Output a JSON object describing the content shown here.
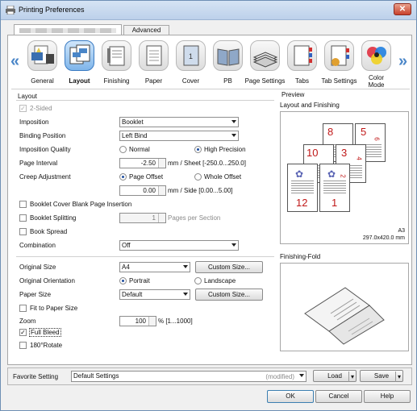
{
  "window": {
    "title": "Printing Preferences",
    "close_glyph": "✕"
  },
  "tabs": [
    {
      "label": ""
    },
    {
      "label": "Advanced"
    }
  ],
  "toolbar": {
    "items": [
      {
        "label": "General"
      },
      {
        "label": "Layout"
      },
      {
        "label": "Finishing"
      },
      {
        "label": "Paper"
      },
      {
        "label": "Cover"
      },
      {
        "label": "PB"
      },
      {
        "label": "Page Settings"
      },
      {
        "label": "Tabs"
      },
      {
        "label": "Tab Settings"
      },
      {
        "label": "Color\nMode"
      }
    ],
    "selected": "Layout"
  },
  "layout": {
    "section_title": "Layout",
    "two_sided": "2-Sided",
    "imposition_label": "Imposition",
    "imposition_value": "Booklet",
    "binding_label": "Binding Position",
    "binding_value": "Left Bind",
    "quality_label": "Imposition Quality",
    "quality_normal": "Normal",
    "quality_high": "High Precision",
    "interval_label": "Page Interval",
    "interval_value": "-2.50",
    "interval_unit": "mm / Sheet [-250.0...250.0]",
    "creep_label": "Creep Adjustment",
    "creep_page_offset": "Page Offset",
    "creep_whole_offset": "Whole Offset",
    "creep_value": "0.00",
    "creep_unit": "mm / Side [0.00...5.00]",
    "cover_blank": "Booklet Cover Blank Page Insertion",
    "splitting": "Booklet Splitting",
    "splitting_value": "1",
    "splitting_unit": "Pages per Section",
    "book_spread": "Book Spread",
    "combination_label": "Combination",
    "combination_value": "Off",
    "original_size_label": "Original Size",
    "original_size_value": "A4",
    "custom_size_1": "Custom Size...",
    "orientation_label": "Original Orientation",
    "orientation_portrait": "Portrait",
    "orientation_landscape": "Landscape",
    "paper_size_label": "Paper Size",
    "paper_size_value": "Default",
    "custom_size_2": "Custom Size...",
    "fit_to_paper": "Fit to Paper Size",
    "zoom_label": "Zoom",
    "zoom_value": "100",
    "zoom_unit": "% [1...1000]",
    "full_bleed": "Full Bleed",
    "rotate": "180°Rotate"
  },
  "preview": {
    "section_title": "Preview",
    "layout_finishing": "Layout and Finishing",
    "pages": [
      "8",
      "5",
      "6",
      "10",
      "3",
      "4",
      "12",
      "1",
      "2"
    ],
    "paper_name": "A3",
    "paper_dims": "297.0x420.0 mm",
    "finishing_fold": "Finishing-Fold"
  },
  "favorite": {
    "label": "Favorite Setting",
    "value": "Default Settings",
    "modified": "(modified)",
    "load": "Load",
    "save": "Save"
  },
  "buttons": {
    "ok": "OK",
    "cancel": "Cancel",
    "help": "Help"
  }
}
